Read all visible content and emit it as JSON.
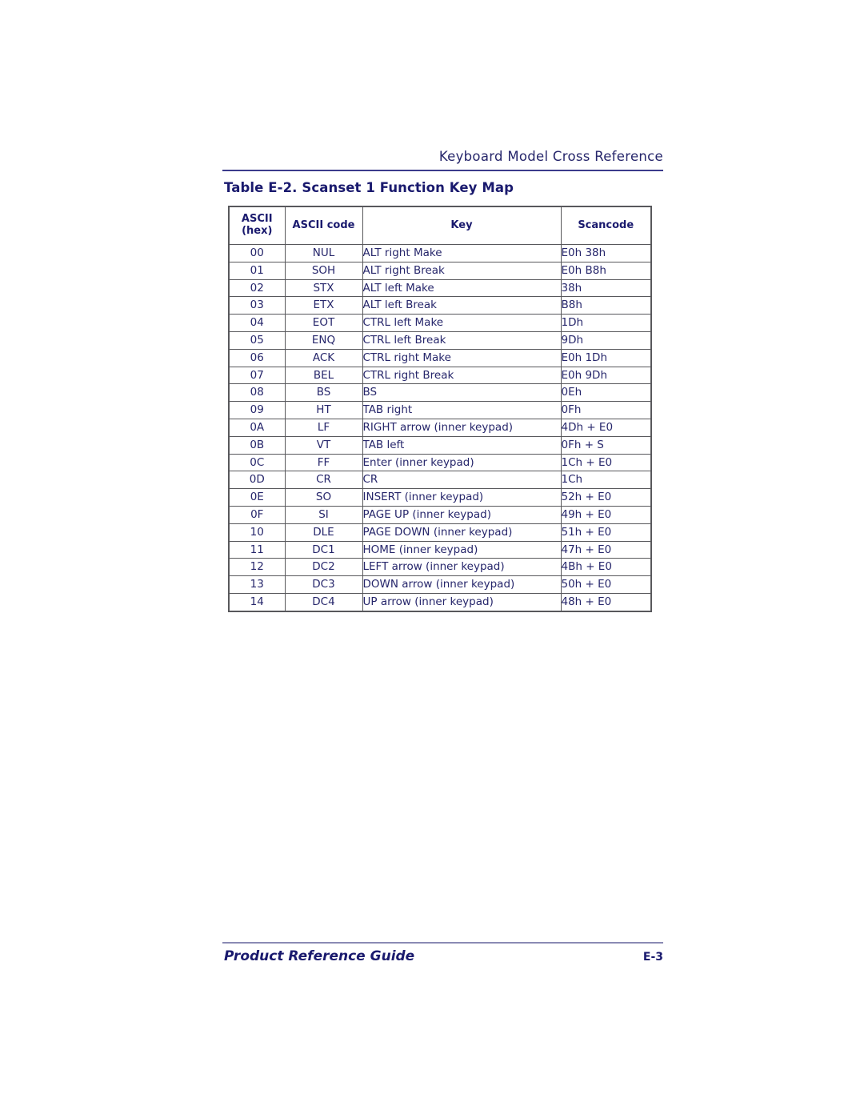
{
  "header": {
    "running_title": "Keyboard Model Cross Reference"
  },
  "table": {
    "caption": "Table E-2. Scanset 1 Function Key Map",
    "columns": [
      {
        "label_line1": "ASCII",
        "label_line2": "(hex)"
      },
      {
        "label_line1": "ASCII code",
        "label_line2": ""
      },
      {
        "label_line1": "Key",
        "label_line2": ""
      },
      {
        "label_line1": "Scancode",
        "label_line2": ""
      }
    ],
    "rows": [
      {
        "hex": "00",
        "code": "NUL",
        "key": "ALT right Make",
        "scancode": "E0h 38h"
      },
      {
        "hex": "01",
        "code": "SOH",
        "key": "ALT right Break",
        "scancode": "E0h B8h"
      },
      {
        "hex": "02",
        "code": "STX",
        "key": "ALT left Make",
        "scancode": "38h"
      },
      {
        "hex": "03",
        "code": "ETX",
        "key": "ALT left Break",
        "scancode": "B8h"
      },
      {
        "hex": "04",
        "code": "EOT",
        "key": "CTRL left Make",
        "scancode": "1Dh"
      },
      {
        "hex": "05",
        "code": "ENQ",
        "key": "CTRL left Break",
        "scancode": "9Dh"
      },
      {
        "hex": "06",
        "code": "ACK",
        "key": "CTRL right Make",
        "scancode": "E0h 1Dh"
      },
      {
        "hex": "07",
        "code": "BEL",
        "key": "CTRL right Break",
        "scancode": "E0h 9Dh"
      },
      {
        "hex": "08",
        "code": "BS",
        "key": "BS",
        "scancode": "0Eh"
      },
      {
        "hex": "09",
        "code": "HT",
        "key": "TAB right",
        "scancode": "0Fh"
      },
      {
        "hex": "0A",
        "code": "LF",
        "key": "RIGHT arrow (inner keypad)",
        "scancode": "4Dh + E0"
      },
      {
        "hex": "0B",
        "code": "VT",
        "key": "TAB left",
        "scancode": "0Fh + S"
      },
      {
        "hex": "0C",
        "code": "FF",
        "key": "Enter (inner keypad)",
        "scancode": "1Ch + E0"
      },
      {
        "hex": "0D",
        "code": "CR",
        "key": "CR",
        "scancode": "1Ch"
      },
      {
        "hex": "0E",
        "code": "SO",
        "key": "INSERT (inner keypad)",
        "scancode": "52h + E0"
      },
      {
        "hex": "0F",
        "code": "SI",
        "key": "PAGE UP (inner keypad)",
        "scancode": "49h + E0"
      },
      {
        "hex": "10",
        "code": "DLE",
        "key": "PAGE DOWN (inner keypad)",
        "scancode": "51h + E0"
      },
      {
        "hex": "11",
        "code": "DC1",
        "key": "HOME (inner keypad)",
        "scancode": "47h + E0"
      },
      {
        "hex": "12",
        "code": "DC2",
        "key": "LEFT arrow (inner keypad)",
        "scancode": "4Bh + E0"
      },
      {
        "hex": "13",
        "code": "DC3",
        "key": "DOWN arrow (inner keypad)",
        "scancode": "50h + E0"
      },
      {
        "hex": "14",
        "code": "DC4",
        "key": "UP arrow (inner keypad)",
        "scancode": "48h + E0"
      }
    ]
  },
  "footer": {
    "title": "Product Reference Guide",
    "page_number": "E-3"
  },
  "colors": {
    "text_navy": "#1a1a6e",
    "rule_navy": "#3b3b8c",
    "rule_footer": "#8a8ab4",
    "table_border": "#58585c",
    "page_background": "#ffffff"
  }
}
